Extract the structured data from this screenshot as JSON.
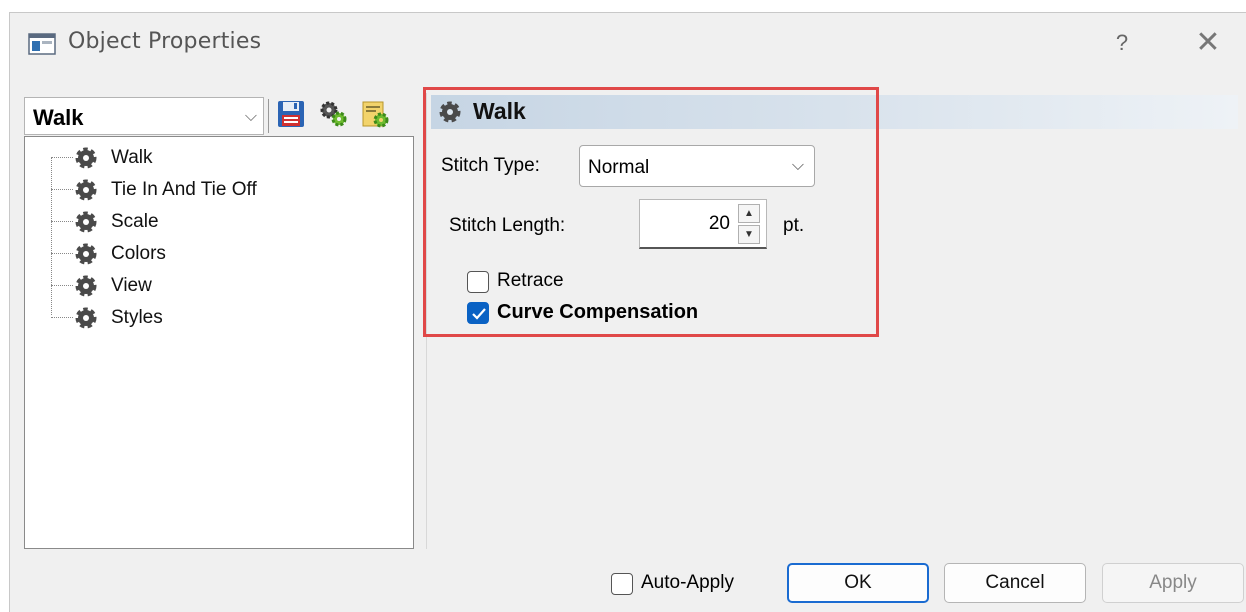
{
  "window": {
    "title": "Object Properties",
    "help_glyph": "?",
    "close_glyph": "✕"
  },
  "left_panel": {
    "object_type_select": {
      "value": "Walk",
      "chevron": "⌵"
    },
    "toolbar_icons": [
      "save-icon",
      "gears-settings-icon",
      "settings-document-icon"
    ],
    "tree_items": [
      {
        "label": "Walk",
        "icon": "gear-icon"
      },
      {
        "label": "Tie In And Tie Off",
        "icon": "gear-icon"
      },
      {
        "label": "Scale",
        "icon": "gear-icon"
      },
      {
        "label": "Colors",
        "icon": "gear-icon"
      },
      {
        "label": "View",
        "icon": "gear-icon"
      },
      {
        "label": "Styles",
        "icon": "gear-icon"
      }
    ]
  },
  "properties_panel": {
    "header": {
      "label": "Walk",
      "icon": "gear-icon"
    },
    "stitch_type": {
      "label": "Stitch Type:",
      "value": "Normal",
      "chevron": "⌵"
    },
    "stitch_length": {
      "label": "Stitch Length:",
      "value": "20",
      "unit": "pt.",
      "spin_up": "▲",
      "spin_down": "▼"
    },
    "retrace": {
      "label": "Retrace",
      "checked": false
    },
    "curve_compensation": {
      "label": "Curve Compensation",
      "checked": true
    }
  },
  "footer": {
    "auto_apply": {
      "label": "Auto-Apply",
      "checked": false
    },
    "ok_label": "OK",
    "cancel_label": "Cancel",
    "apply_label": "Apply"
  },
  "colors": {
    "highlight_border": "#e04848",
    "checkbox_checked": "#0a62c4",
    "ok_border": "#1a6bd1",
    "header_gradient_start": "#c6d5e4"
  }
}
